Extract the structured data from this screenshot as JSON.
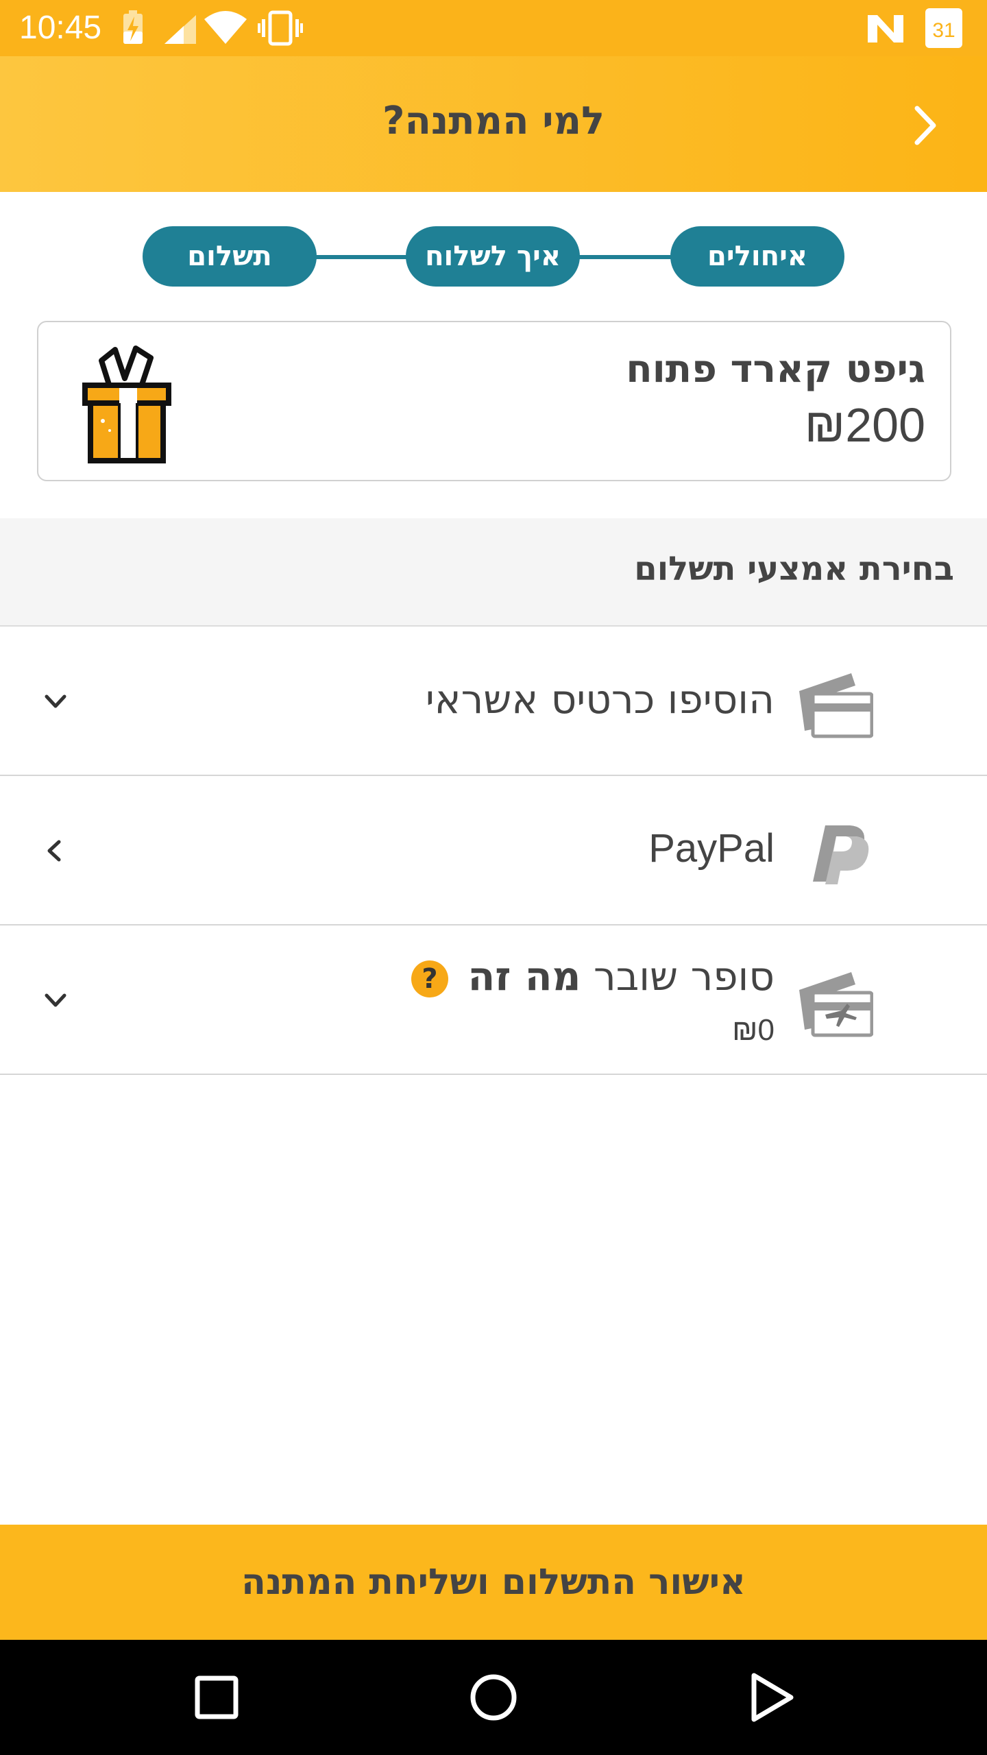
{
  "status_bar": {
    "time": "10:45",
    "icons": [
      "battery-charging-icon",
      "signal-icon",
      "wifi-icon",
      "vibrate-icon",
      "n-icon",
      "calendar-icon"
    ],
    "calendar_day": "31"
  },
  "header": {
    "title": "למי המתנה?",
    "back_icon": "chevron-right-icon"
  },
  "stepper": {
    "steps": [
      {
        "label": "איחולים",
        "active": true
      },
      {
        "label": "איך לשלוח",
        "active": true
      },
      {
        "label": "תשלום",
        "active": true
      }
    ]
  },
  "gift_card": {
    "name": "גיפט קארד פתוח",
    "amount": "₪200",
    "icon": "gift-box-icon"
  },
  "payment_section": {
    "title": "בחירת אמצעי תשלום",
    "methods": [
      {
        "label": "הוסיפו כרטיס אשראי",
        "icon": "credit-card-icon",
        "chevron": "chevron-down-icon"
      },
      {
        "label": "PayPal",
        "icon": "paypal-icon",
        "chevron": "chevron-left-icon"
      },
      {
        "label": "סופר שובר",
        "help_label": "מה זה",
        "help_icon": "?",
        "sub_value": "₪0",
        "icon": "voucher-icon",
        "chevron": "chevron-down-icon"
      }
    ]
  },
  "cta": {
    "label": "אישור התשלום ושליחת המתנה"
  },
  "nav_bar": {
    "buttons": [
      "recents-square-icon",
      "home-circle-icon",
      "back-triangle-icon"
    ]
  },
  "colors": {
    "accent": "#fbb31a",
    "stepper": "#1f8095",
    "text": "#444444"
  }
}
